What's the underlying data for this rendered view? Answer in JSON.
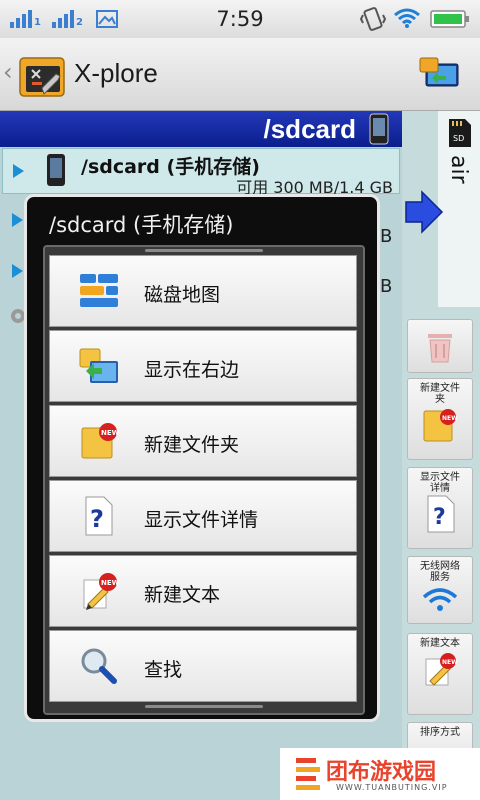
{
  "status_bar": {
    "time": "7:59",
    "sim1_label": "1",
    "sim2_label": "2",
    "icons": [
      "signal-sim1-icon",
      "signal-sim2-icon",
      "picture-icon",
      "vibrate-icon",
      "wifi-icon",
      "battery-icon"
    ]
  },
  "app": {
    "title": "X-plore",
    "back_glyph": "‹"
  },
  "left_pane": {
    "path_title": "/sdcard",
    "selected_item": {
      "name": "/sdcard (手机存储)",
      "info": "可用 300 MB/1.4 GB"
    },
    "partial_texts": [
      "B",
      "B"
    ]
  },
  "right_pane": {
    "header_text": "air",
    "buttons": [
      {
        "label": "",
        "icon": "trash-icon"
      },
      {
        "label": "新建文件夹",
        "icon": "new-folder-icon"
      },
      {
        "label": "显示文件详情",
        "icon": "file-details-icon"
      },
      {
        "label": "无线网络服务",
        "icon": "wifi-icon"
      },
      {
        "label": "新建文本",
        "icon": "new-text-icon"
      },
      {
        "label": "排序方式",
        "icon": "sort-icon"
      }
    ]
  },
  "dialog": {
    "title": "/sdcard (手机存储)",
    "items": [
      {
        "label": "磁盘地图",
        "icon": "disk-map-icon"
      },
      {
        "label": "显示在右边",
        "icon": "show-right-icon"
      },
      {
        "label": "新建文件夹",
        "icon": "new-folder-icon"
      },
      {
        "label": "显示文件详情",
        "icon": "file-details-icon"
      },
      {
        "label": "新建文本",
        "icon": "new-text-icon"
      },
      {
        "label": "查找",
        "icon": "search-icon"
      }
    ]
  },
  "watermark": {
    "title": "团布游戏园",
    "url": "WWW.TUANBUTING.VIP"
  },
  "colors": {
    "path_header": "#1a2fa8",
    "selected_row": "#cfe9ea",
    "accent_arrow": "#1b8fd6",
    "watermark_red": "#e8432c"
  }
}
